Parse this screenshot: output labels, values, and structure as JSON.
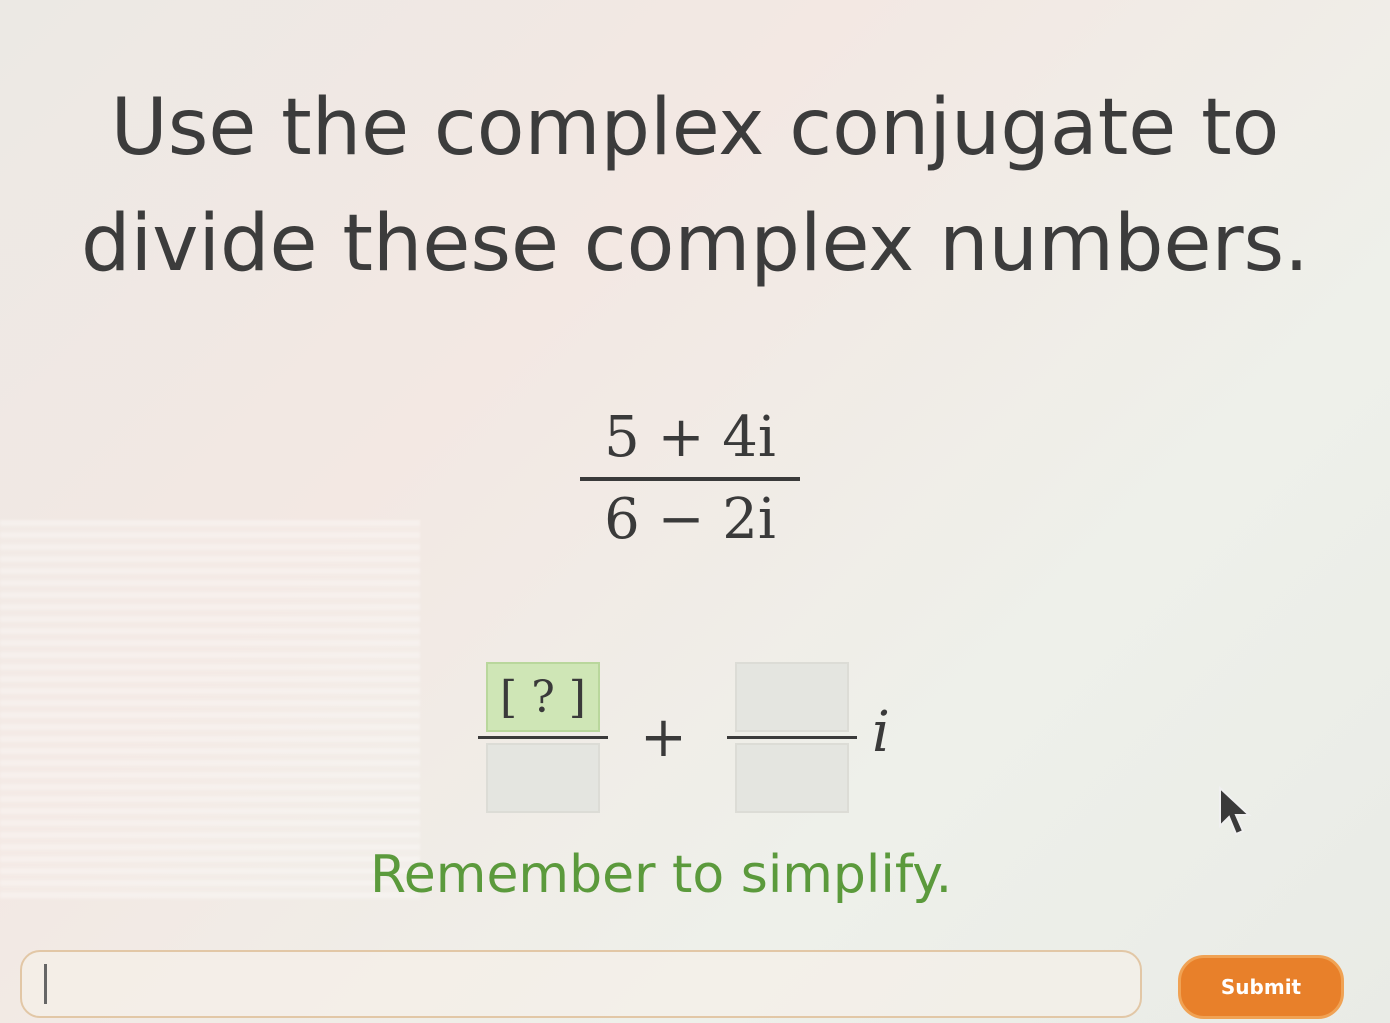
{
  "prompt": {
    "line1": "Use the complex conjugate to",
    "line2": "divide these complex numbers."
  },
  "problem": {
    "numerator": "5 + 4i",
    "denominator": "6 − 2i"
  },
  "answer_template": {
    "real_numerator_placeholder": "[ ? ]",
    "real_denominator": "",
    "plus_sign": "+",
    "imag_numerator": "",
    "imag_denominator": "",
    "imaginary_unit": "i"
  },
  "hint": "Remember to simplify.",
  "answer_input": {
    "value": ""
  },
  "submit_label": "Submit",
  "colors": {
    "hint_text": "#5b9a3c",
    "active_box": "#cfe6b6",
    "submit_button": "#e8802a"
  },
  "icons": {
    "mouse_pointer": "mouse-pointer-icon"
  }
}
